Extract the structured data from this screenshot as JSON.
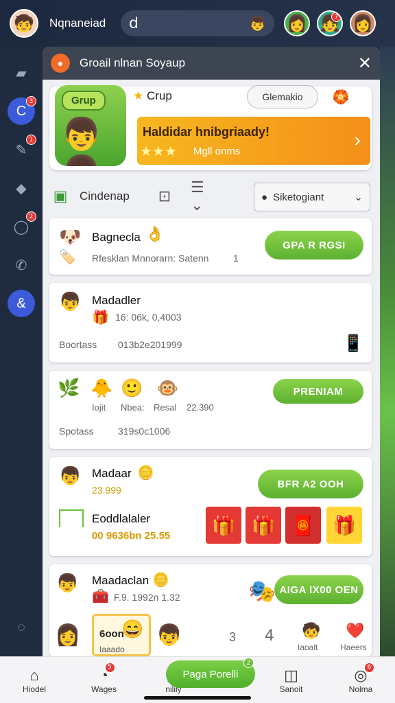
{
  "topbar": {
    "app_name": "Nqnaneiad",
    "search_glyph": "ⅾ",
    "user_badge": "7"
  },
  "sidebar": {
    "items": [
      {
        "name": "folder",
        "badge": ""
      },
      {
        "name": "chat",
        "badge": "3"
      },
      {
        "name": "edit",
        "badge": "1"
      },
      {
        "name": "hat",
        "badge": ""
      },
      {
        "name": "message",
        "badge": "2"
      },
      {
        "name": "phone",
        "badge": ""
      },
      {
        "name": "group",
        "badge": ""
      }
    ]
  },
  "modal": {
    "title": "Groail nlnan Soyaup",
    "group_chip_label": "Grup",
    "crup_label": "Crup",
    "grey_pill": "Glemakio",
    "banner_headline": "Haldidar hnibgriaady!",
    "banner_sub": "Mgll onms",
    "toolbar_label": "Cindenap",
    "select_value": "Siketogiant"
  },
  "cards": [
    {
      "title": "Bagnecla",
      "sub": "Rfesklan Mnnorarn: Satenn",
      "count": "1",
      "button": "GPA R RGSI"
    },
    {
      "title": "Madadler",
      "sub": "16: 06k, 0,4003",
      "bottom_label": "Boortass",
      "bottom_value": "013b2e201999"
    },
    {
      "labels": [
        "Iojit",
        "Nbea:",
        "Resal",
        "22.390"
      ],
      "button": "PRENIAM",
      "bottom_label": "Spotass",
      "bottom_value": "319s0c1006"
    },
    {
      "title": "Madaar",
      "sub": "23.999",
      "button": "BFR A2 OOH",
      "sub_title": "Eoddlalaler",
      "yellow": "00 9636bn 25.55"
    },
    {
      "title": "Maadaclan",
      "sub": "F.9. 1992n 1.32",
      "button": "AIGA IX00 OEN",
      "mini_card": "6oon",
      "mini_sub": "Iaaado",
      "nums": [
        "3",
        "4"
      ],
      "right_labels": [
        "Iaoalt",
        "Haeers"
      ]
    }
  ],
  "bottomnav": {
    "items": [
      {
        "label": "Hiodel",
        "badge": ""
      },
      {
        "label": "Wages",
        "badge": "5"
      },
      {
        "label": "niliiy",
        "badge": ""
      },
      {
        "label": "Sanoit",
        "badge": ""
      },
      {
        "label": "Nolma",
        "badge": "6"
      }
    ],
    "cta": "Paga Porelli",
    "cta_badge": "2"
  }
}
